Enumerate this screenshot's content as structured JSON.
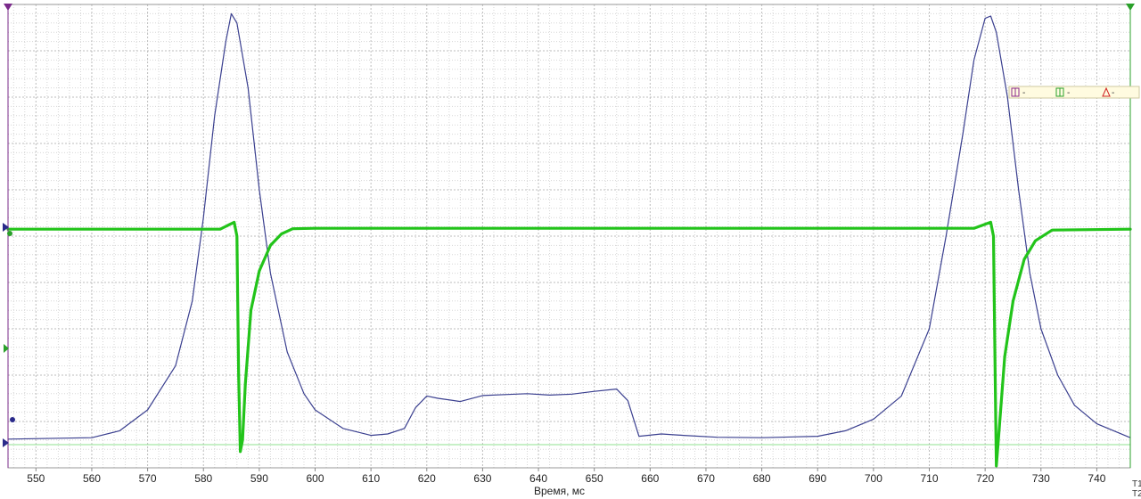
{
  "chart_data": {
    "type": "line",
    "xlabel": "Время, мс",
    "xlim": [
      545,
      746
    ],
    "ylim": [
      0,
      100
    ],
    "x_ticks": [
      550,
      560,
      570,
      580,
      590,
      600,
      610,
      620,
      630,
      640,
      650,
      660,
      670,
      680,
      690,
      700,
      710,
      720,
      730,
      740
    ],
    "grid": true,
    "series": [
      {
        "color": "#3a3f8f",
        "points": [
          [
            545,
            6.2
          ],
          [
            560,
            6.5
          ],
          [
            565,
            8.0
          ],
          [
            570,
            12.5
          ],
          [
            575,
            22.0
          ],
          [
            578,
            36.0
          ],
          [
            580,
            54.0
          ],
          [
            582,
            76.0
          ],
          [
            584,
            92.0
          ],
          [
            585,
            98.0
          ],
          [
            586,
            96.0
          ],
          [
            588,
            82.0
          ],
          [
            590,
            60.0
          ],
          [
            592,
            42.0
          ],
          [
            595,
            25.0
          ],
          [
            598,
            16.0
          ],
          [
            600,
            12.5
          ],
          [
            605,
            8.5
          ],
          [
            610,
            7.0
          ],
          [
            613,
            7.3
          ],
          [
            616,
            8.5
          ],
          [
            618,
            13.0
          ],
          [
            620,
            15.5
          ],
          [
            622,
            15.0
          ],
          [
            626,
            14.3
          ],
          [
            630,
            15.6
          ],
          [
            634,
            15.8
          ],
          [
            638,
            16.0
          ],
          [
            642,
            15.7
          ],
          [
            646,
            15.9
          ],
          [
            650,
            16.5
          ],
          [
            654,
            17.0
          ],
          [
            656,
            14.5
          ],
          [
            658,
            6.8
          ],
          [
            662,
            7.3
          ],
          [
            666,
            7.0
          ],
          [
            672,
            6.6
          ],
          [
            680,
            6.5
          ],
          [
            690,
            6.8
          ],
          [
            695,
            8.0
          ],
          [
            700,
            10.5
          ],
          [
            705,
            15.5
          ],
          [
            710,
            30.0
          ],
          [
            713,
            50.0
          ],
          [
            716,
            72.0
          ],
          [
            718,
            88.0
          ],
          [
            720,
            97.0
          ],
          [
            721,
            97.5
          ],
          [
            722,
            94.0
          ],
          [
            724,
            80.0
          ],
          [
            726,
            60.0
          ],
          [
            728,
            42.0
          ],
          [
            730,
            30.0
          ],
          [
            733,
            20.0
          ],
          [
            736,
            13.5
          ],
          [
            740,
            9.5
          ],
          [
            746,
            6.5
          ]
        ]
      },
      {
        "color": "#22c41a",
        "points": [
          [
            545,
            51.5
          ],
          [
            570,
            51.5
          ],
          [
            583,
            51.5
          ],
          [
            585.5,
            53.0
          ],
          [
            586.0,
            50.0
          ],
          [
            586.3,
            20.0
          ],
          [
            586.6,
            3.5
          ],
          [
            587.0,
            6.0
          ],
          [
            587.5,
            18.0
          ],
          [
            588.5,
            34.0
          ],
          [
            590,
            42.5
          ],
          [
            592,
            48.0
          ],
          [
            594,
            50.5
          ],
          [
            596,
            51.6
          ],
          [
            600,
            51.7
          ],
          [
            650,
            51.7
          ],
          [
            700,
            51.7
          ],
          [
            718,
            51.7
          ],
          [
            721,
            53.0
          ],
          [
            721.5,
            50.0
          ],
          [
            721.8,
            20.0
          ],
          [
            722.0,
            0.4
          ],
          [
            722.5,
            8.0
          ],
          [
            723.5,
            24.0
          ],
          [
            725,
            36.0
          ],
          [
            727,
            45.0
          ],
          [
            729,
            49.0
          ],
          [
            732,
            51.3
          ],
          [
            746,
            51.5
          ]
        ]
      }
    ]
  },
  "cursor_box": {
    "items": [
      {
        "label": "-",
        "icon": "vertical-cursor-purple-icon",
        "color": "#8b2a8b"
      },
      {
        "label": "-",
        "icon": "vertical-cursor-green-icon",
        "color": "#2aa02a"
      },
      {
        "label": "-",
        "icon": "delta-icon",
        "color": "#d02020"
      }
    ]
  },
  "corner_labels": {
    "top": "T1",
    "bottom": "T2"
  }
}
